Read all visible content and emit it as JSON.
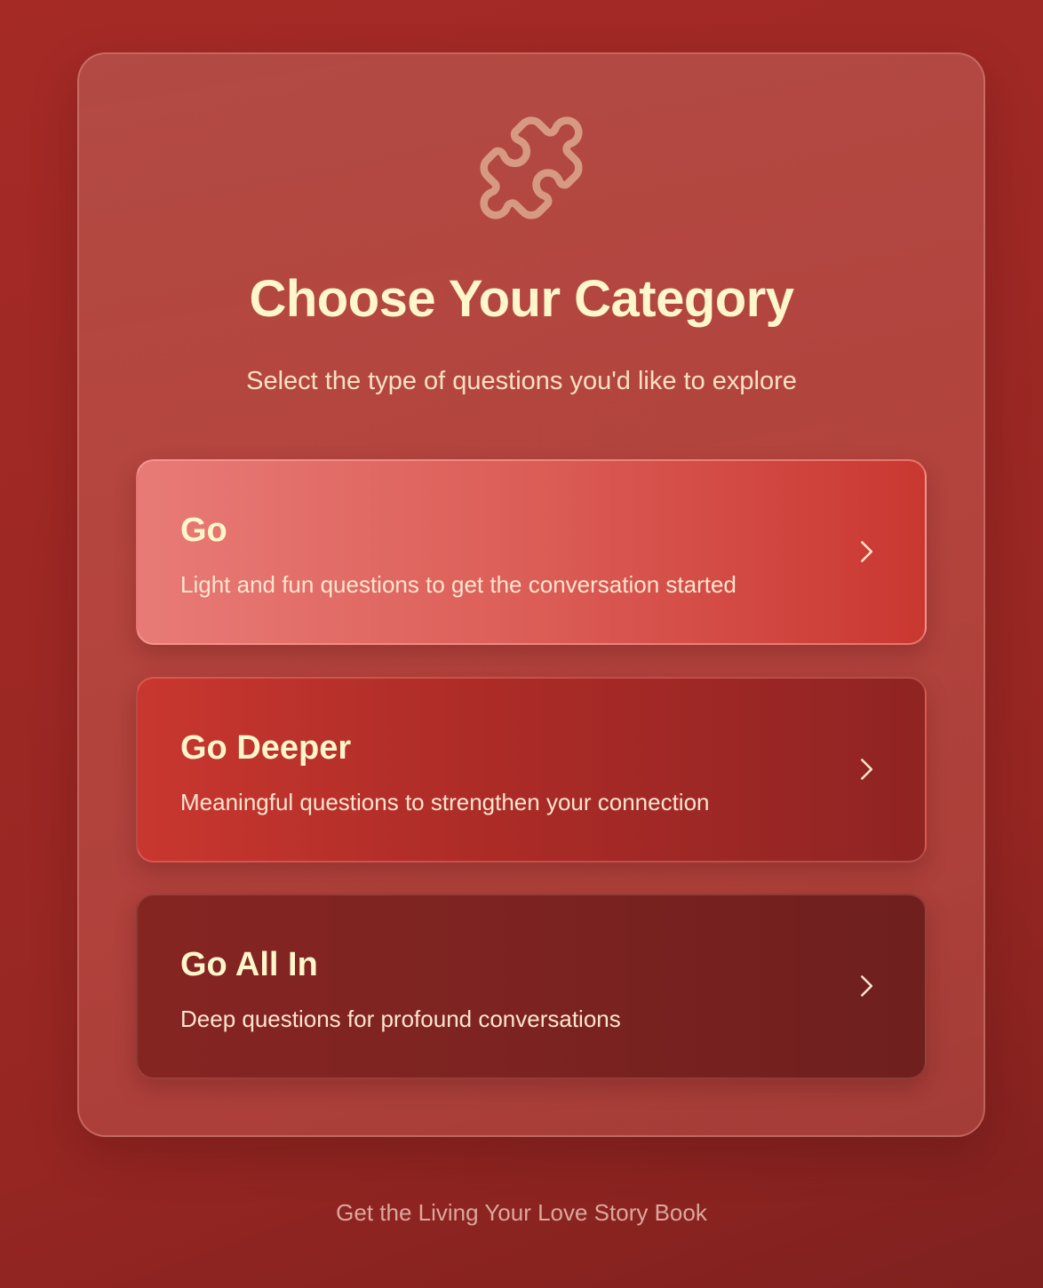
{
  "header": {
    "icon": "puzzle-icon",
    "title": "Choose Your Category",
    "subtitle": "Select the type of questions you'd like to explore"
  },
  "categories": [
    {
      "title": "Go",
      "description": "Light and fun questions to get the conversation started",
      "icon": "chevron-right-icon"
    },
    {
      "title": "Go Deeper",
      "description": "Meaningful questions to strengthen your connection",
      "icon": "chevron-right-icon"
    },
    {
      "title": "Go All In",
      "description": "Deep questions for profound conversations",
      "icon": "chevron-right-icon"
    }
  ],
  "footer": {
    "link_label": "Get the Living Your Love Story Book"
  },
  "colors": {
    "background": "#9d2824",
    "title_text": "#fff6cc",
    "icon_stroke": "#d69a82",
    "go_card": "#dc5d57",
    "go_deeper_card": "#ac2b27",
    "go_all_in_card": "#7c2321"
  }
}
